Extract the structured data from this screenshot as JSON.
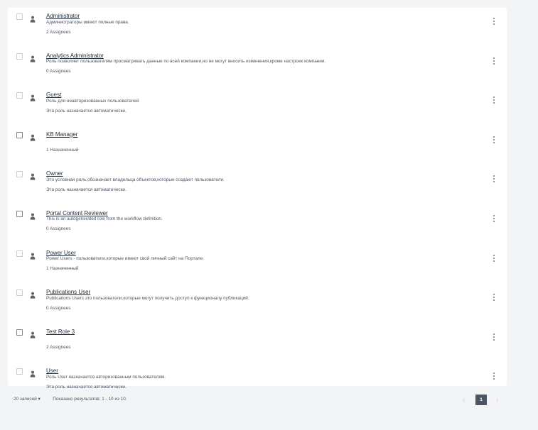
{
  "roles": [
    {
      "name": "Administrator",
      "description": "Администраторы имеют полные права.",
      "assignees": "2 Assignees",
      "checkbox_style": "light"
    },
    {
      "name": "Analytics Administrator",
      "description": "Роль позволяет пользователям просматривать данные по всей компании,но не могут вносить изменения,кроме настроек компании.",
      "assignees": "0 Assignees",
      "checkbox_style": "light"
    },
    {
      "name": "Guest",
      "description": "Роль для неавторизованных пользователей",
      "assignees": "Эта роль назначается автоматически.",
      "checkbox_style": "light"
    },
    {
      "name": "KB Manager",
      "description": "",
      "assignees": "1 Назначенный",
      "checkbox_style": "dark"
    },
    {
      "name": "Owner",
      "description": "Это условная роль,обозначает владельца объектов,которые создают пользователи.",
      "assignees": "Эта роль назначается автоматически.",
      "checkbox_style": "light"
    },
    {
      "name": "Portal Content Reviewer",
      "description": "This is an autogenerated role from the workflow definition.",
      "assignees": "0 Assignees",
      "checkbox_style": "dark"
    },
    {
      "name": "Power User",
      "description": "Power Users - пользователи,которые имеют свой личный сайт на Портале.",
      "assignees": "1 Назначенный",
      "checkbox_style": "light"
    },
    {
      "name": "Publications User",
      "description": "Publications Users это пользователи,которые могут получить доступ к функционалу публикаций.",
      "assignees": "0 Assignees",
      "checkbox_style": "light"
    },
    {
      "name": "Test Role 3",
      "description": "",
      "assignees": "2 Assignees",
      "checkbox_style": "dark"
    },
    {
      "name": "User",
      "description": "Роль User назначается авторизованным пользователям.",
      "assignees": "Эта роль назначается автоматически.",
      "checkbox_style": "light"
    }
  ],
  "footer": {
    "per_page": "20 записей",
    "per_page_caret": "▾",
    "results": "Показано результатов: 1 - 10 из 10."
  },
  "pagination": {
    "prev": "‹",
    "current": "1",
    "next": "›"
  },
  "icons": {
    "row_icon": "user-icon",
    "menu_icon": "kebab-icon"
  },
  "colors": {
    "background": "#f3f4f6",
    "panel": "#ffffff",
    "active_page": "#4b5563"
  }
}
